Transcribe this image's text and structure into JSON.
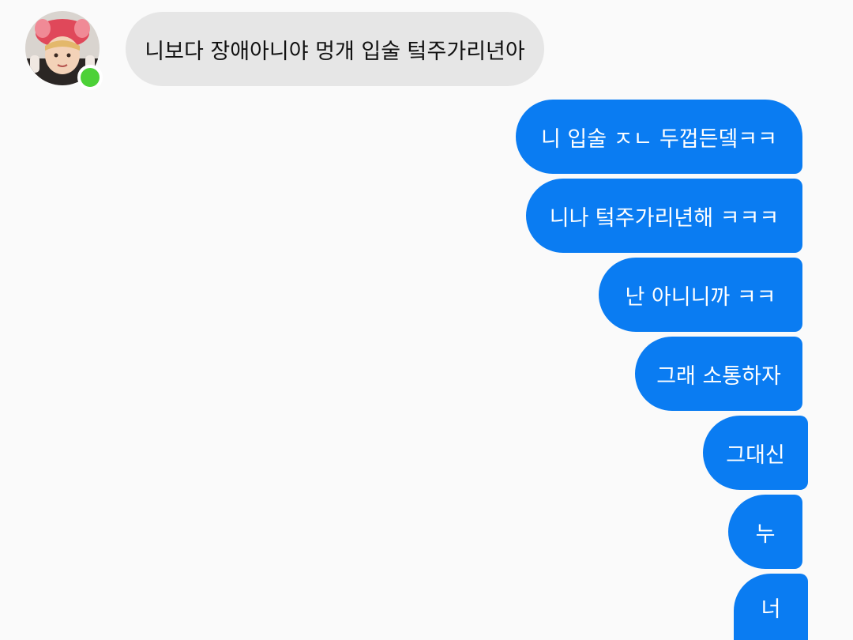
{
  "contact": {
    "avatar_icon": "user-avatar-photo",
    "online_status": "online",
    "online_color": "#4cd137"
  },
  "messages": {
    "incoming": [
      {
        "text": "니보다 장애아니야 멍개 입술 텈주가리년아"
      }
    ],
    "outgoing": [
      {
        "text": "니 입술 ㅈㄴ 두껍든뎈ㅋㅋ"
      },
      {
        "text": "니나 텈주가리년해 ㅋㅋㅋ"
      },
      {
        "text": "난 아니니까 ㅋㅋ"
      },
      {
        "text": "그래 소통하자"
      },
      {
        "text": "그대신"
      },
      {
        "text": "누"
      },
      {
        "text": "너"
      }
    ]
  },
  "colors": {
    "incoming_bubble": "#e6e6e6",
    "outgoing_bubble": "#0a7cf2",
    "background": "#fafafa"
  }
}
